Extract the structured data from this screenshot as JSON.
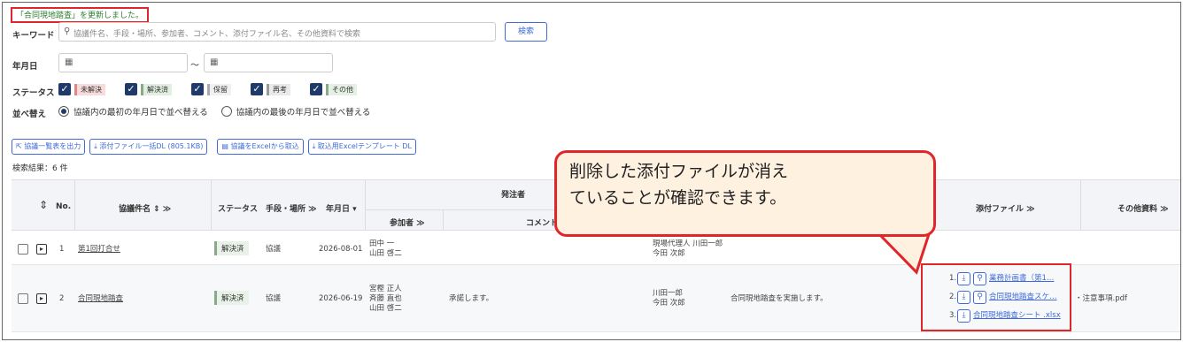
{
  "notice": "「合同現地踏査」を更新しました。",
  "filters": {
    "keyword_label": "キーワード",
    "keyword_placeholder": "協議件名、手段・場所、参加者、コメント、添付ファイル名、その他資料で検索",
    "search_button": "検索",
    "date_label": "年月日",
    "date_tilde": "～",
    "status_label": "ステータス",
    "statuses": [
      {
        "label": "未解決",
        "checked": true,
        "color": "#f8dcdc"
      },
      {
        "label": "解決済",
        "checked": true,
        "color": "#e0efe0"
      },
      {
        "label": "保留",
        "checked": true,
        "color": "#f0f0f0"
      },
      {
        "label": "再考",
        "checked": true,
        "color": "#eaeaea"
      },
      {
        "label": "その他",
        "checked": true,
        "color": "#e5f0e5"
      }
    ],
    "sort_label": "並べ替え",
    "sort_options": [
      "協議内の最初の年月日で並べ替える",
      "協議内の最後の年月日で並べ替える"
    ]
  },
  "actions": [
    "協議一覧表を出力",
    "添付ファイル一括DL (805.1KB)",
    "協議をExcelから取込",
    "取込用Excelテンプレート DL"
  ],
  "result_count": "検索結果：6 件",
  "table": {
    "headers": {
      "no": "No.",
      "title": "協議件名 ⇕ ≫",
      "status": "ステータス",
      "method": "手段・場所 ≫",
      "date": "年月日 ▾",
      "orderer": "発注者",
      "participants": "参加者 ≫",
      "comment": "コメント",
      "attachments": "添付ファイル ≫",
      "others": "その他資料 ≫"
    },
    "rows": [
      {
        "no": "1",
        "title": "第1回打合せ",
        "status": "解決済",
        "method": "協議",
        "date": "2026-08-01",
        "participants": [
          "田中 一",
          "山田 啓二"
        ],
        "contractor": [
          "現場代理人 川田一郎",
          "今田 次郎"
        ],
        "comment": "",
        "attachments": [],
        "others": ""
      },
      {
        "no": "2",
        "title": "合同現地踏査",
        "status": "解決済",
        "method": "協議",
        "date": "2026-06-19",
        "participants": [
          "宮樫 正人",
          "斉藤 直也",
          "山田 啓二"
        ],
        "orderer_comment": "承諾します。",
        "contractor": [
          "川田一郎",
          "今田 次郎"
        ],
        "comment": "合同現地踏査を実施します。",
        "attachments": [
          "1. 業務計画書（第1…",
          "2. 合同現地踏査スケ…",
          "3. 合同現地踏査シート .xlsx"
        ],
        "others": "注意事項.pdf"
      }
    ]
  },
  "callout": [
    "削除した添付ファイルが消え",
    "ていることが確認できます。"
  ]
}
